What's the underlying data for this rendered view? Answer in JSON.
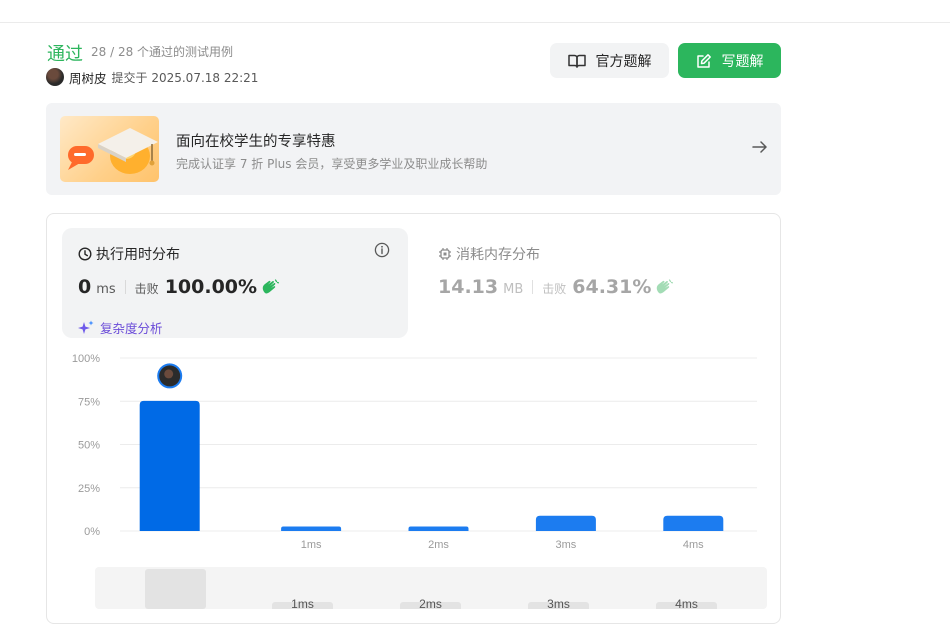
{
  "header": {
    "status": "通过",
    "cases": "28 / 28 个通过的测试用例",
    "user_name": "周树皮",
    "submit_time": "提交于 2025.07.18 22:21"
  },
  "buttons": {
    "official_label": "官方题解",
    "write_label": "写题解"
  },
  "promo": {
    "title": "面向在校学生的专享特惠",
    "subtitle": "完成认证享 7 折 Plus 会员，享受更多学业及职业成长帮助"
  },
  "runtime": {
    "title": "执行用时分布",
    "value": "0",
    "unit": "ms",
    "beats_label": "击败",
    "beats_pct": "100.00%",
    "complexity_label": "复杂度分析"
  },
  "memory": {
    "title": "消耗内存分布",
    "value": "14.13",
    "unit": "MB",
    "beats_label": "击败",
    "beats_pct": "64.31%"
  },
  "chart_data": {
    "type": "bar",
    "categories": [
      "0ms",
      "1ms",
      "2ms",
      "3ms",
      "4ms"
    ],
    "tick_labels": [
      "",
      "1ms",
      "2ms",
      "3ms",
      "4ms"
    ],
    "values": [
      75.2,
      2.6,
      2.6,
      8.8,
      8.8
    ],
    "ylim": [
      0,
      100
    ],
    "yticks": [
      "0%",
      "25%",
      "50%",
      "75%",
      "100%"
    ],
    "highlight_index": 0,
    "grid": true
  },
  "navigator": {
    "labels": [
      "1ms",
      "2ms",
      "3ms",
      "4ms"
    ]
  },
  "colors": {
    "accent_green": "#2cb65d",
    "bar_blue": "#006ae6",
    "bar_blue_light": "#1c7cf0"
  }
}
